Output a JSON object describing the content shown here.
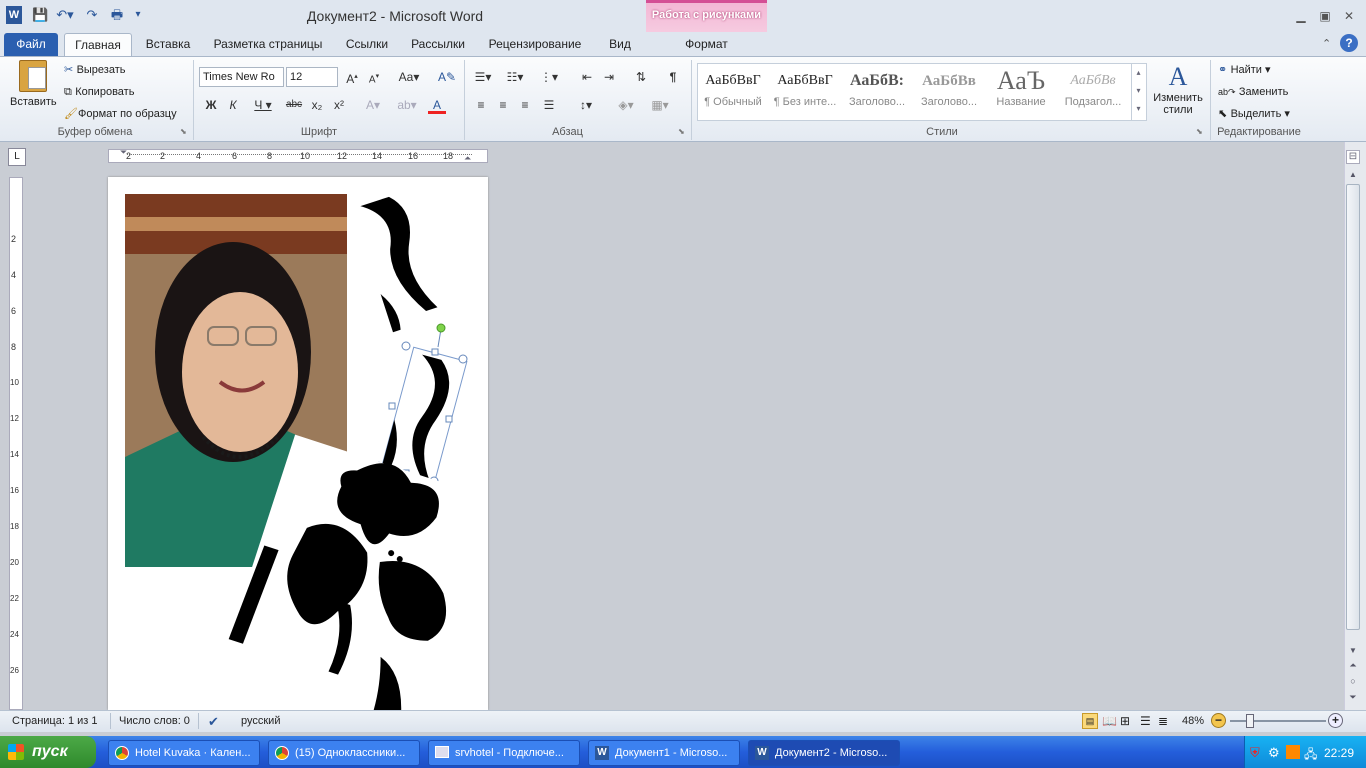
{
  "window": {
    "title": "Документ2 - Microsoft Word",
    "context_tab_group": "Работа с рисунками"
  },
  "tabs": [
    "Файл",
    "Главная",
    "Вставка",
    "Разметка страницы",
    "Ссылки",
    "Рассылки",
    "Рецензирование",
    "Вид",
    "Формат"
  ],
  "clipboard": {
    "paste": "Вставить",
    "cut": "Вырезать",
    "copy": "Копировать",
    "format_painter": "Формат по образцу",
    "label": "Буфер обмена"
  },
  "font": {
    "name": "Times New Ro",
    "size": "12",
    "label": "Шрифт"
  },
  "paragraph": {
    "label": "Абзац"
  },
  "styles": {
    "label": "Стили",
    "items": [
      {
        "sample": "АаБбВвГ",
        "name": "¶ Обычный"
      },
      {
        "sample": "АаБбВвГ",
        "name": "¶ Без инте..."
      },
      {
        "sample": "АаБбВ:",
        "name": "Заголово..."
      },
      {
        "sample": "АаБбВв",
        "name": "Заголово..."
      },
      {
        "sample": "АаЪ",
        "name": "Название"
      },
      {
        "sample": "АаБбВв",
        "name": "Подзагол..."
      }
    ],
    "change": "Изменить стили"
  },
  "editing": {
    "label": "Редактирование",
    "find": "Найти",
    "replace": "Заменить",
    "select": "Выделить"
  },
  "ruler": {
    "h_ticks": [
      "2",
      "4",
      "6",
      "8",
      "10",
      "12",
      "14",
      "16",
      "18"
    ],
    "v_ticks": [
      "2",
      "4",
      "6",
      "8",
      "10",
      "12",
      "14",
      "16",
      "18",
      "20",
      "22",
      "24",
      "26"
    ]
  },
  "status": {
    "page": "Страница: 1 из 1",
    "words": "Число слов: 0",
    "language": "русский",
    "zoom": "48%"
  },
  "taskbar": {
    "start": "пуск",
    "items": [
      "Hotel Kuvaka · Кален...",
      "(15) Одноклассники...",
      "srvhotel - Подключе...",
      "Документ1 - Microso...",
      "Документ2 - Microso..."
    ],
    "clock": "22:29"
  },
  "colors": {
    "file_tab": "#2a5fb0",
    "context_accent": "#d44f95",
    "taskbar": "#245edb",
    "start": "#3a9a37"
  }
}
